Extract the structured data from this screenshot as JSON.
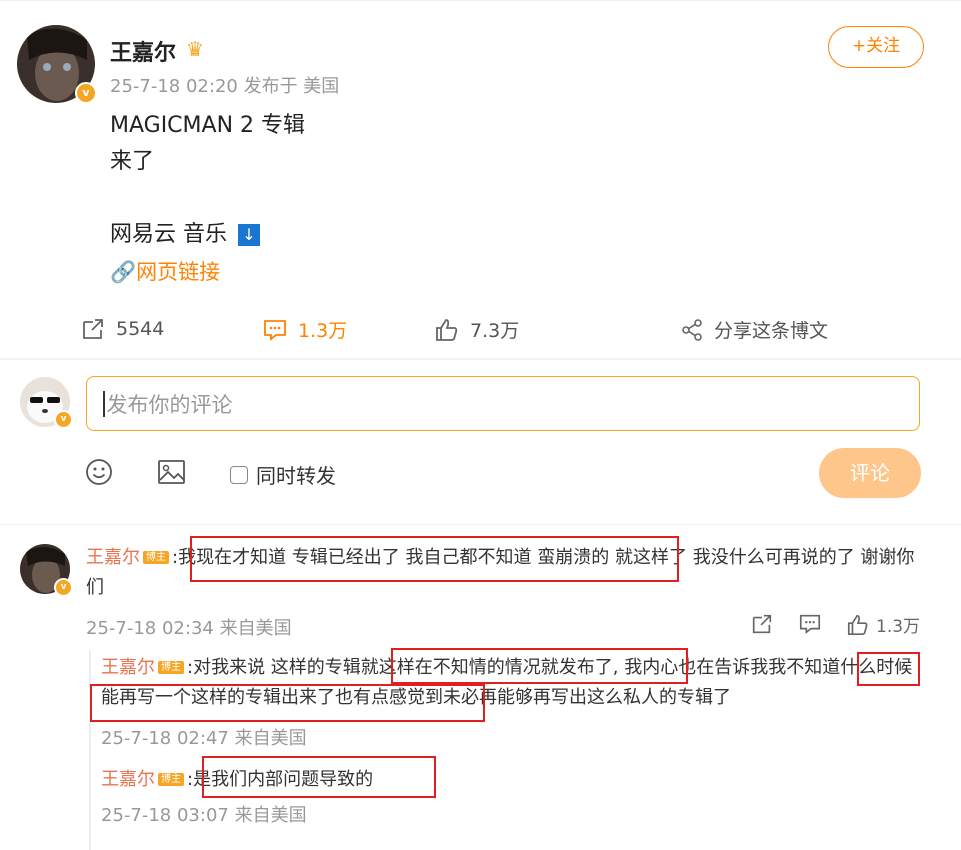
{
  "post": {
    "author": "王嘉尔",
    "meta": "25-7-18 02:20 发布于 美国",
    "follow_label": "+关注",
    "lines": [
      "MAGICMAN 2 专辑",
      "来了",
      "网易云 音乐"
    ],
    "link_label": "网页链接",
    "stats": {
      "reposts": "5544",
      "comments": "1.3万",
      "likes": "7.3万",
      "share": "分享这条博文"
    }
  },
  "composer": {
    "placeholder": "发布你的评论",
    "repost_label": "同时转发",
    "submit_label": "评论"
  },
  "comment": {
    "author": "王嘉尔",
    "tag": "博主",
    "text_prefix": ":",
    "text_highlight": "我现在才知道 专辑已经出了 我自己都不知道 蛮崩溃的",
    "text_rest": " 就这样了 我没什么可再说的了 谢谢你们",
    "meta": "25-7-18 02:34 来自美国",
    "likes": "1.3万",
    "replies": [
      {
        "author": "王嘉尔",
        "tag": "博主",
        "text": ":对我来说 这样的专辑就这样在不知情的情况就发布了, 我内心也在告诉我我不知道什么时候能再写一个这样的专辑出来了也有点感觉到未必再能够再写出这么私人的专辑了",
        "meta": "25-7-18 02:47 来自美国"
      },
      {
        "author": "王嘉尔",
        "tag": "博主",
        "text": ":是我们内部问题导致的",
        "meta": "25-7-18 03:07 来自美国"
      }
    ]
  },
  "colors": {
    "accent": "#ff8200",
    "highlight_box": "#e02020",
    "name": "#eb7350"
  }
}
